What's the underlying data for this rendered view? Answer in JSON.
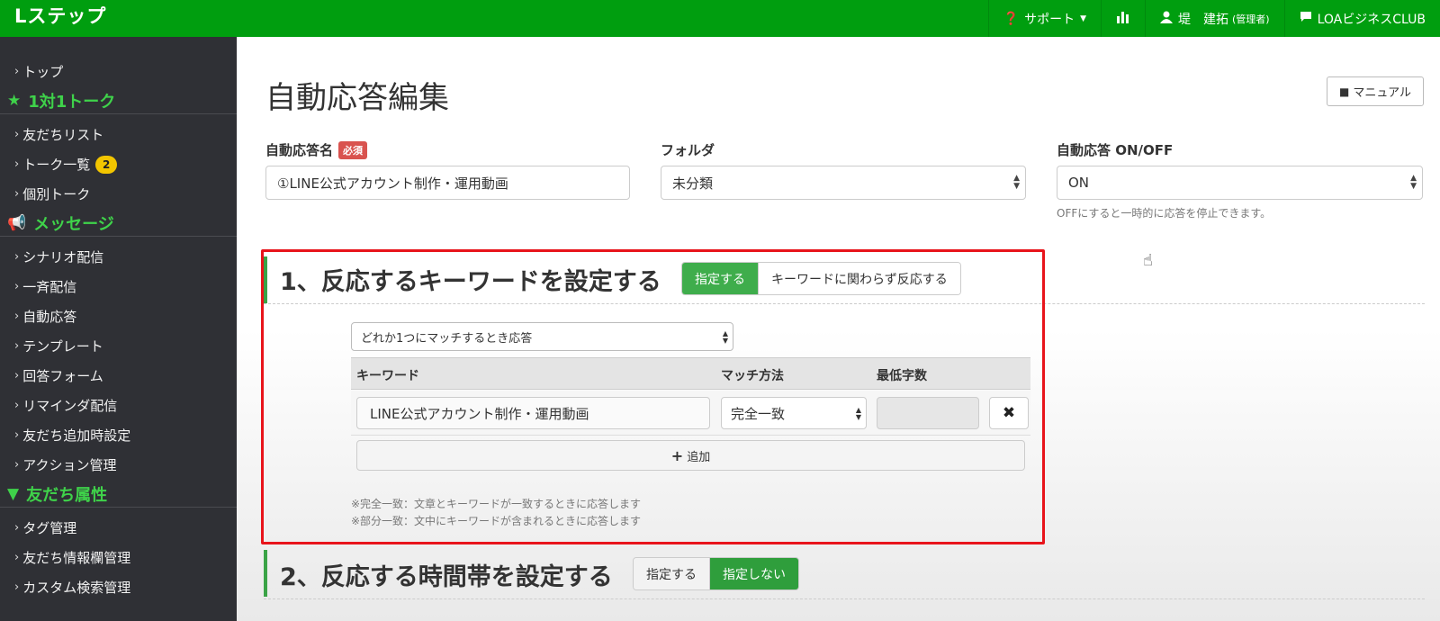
{
  "app": {
    "logo": "Lステップ"
  },
  "topnav": {
    "support": "サポート",
    "user_name": "堤　建拓",
    "user_role": "(管理者)",
    "club": "LOAビジネスCLUB"
  },
  "sidebar": {
    "items": [
      {
        "label": "トップ"
      },
      {
        "header": "1対1トーク",
        "icon": "star-icon"
      },
      {
        "label": "友だちリスト"
      },
      {
        "label": "トーク一覧",
        "badge": "2"
      },
      {
        "label": "個別トーク"
      },
      {
        "header": "メッセージ",
        "icon": "megaphone-icon"
      },
      {
        "label": "シナリオ配信"
      },
      {
        "label": "一斉配信"
      },
      {
        "label": "自動応答"
      },
      {
        "label": "テンプレート"
      },
      {
        "label": "回答フォーム"
      },
      {
        "label": "リマインダ配信"
      },
      {
        "label": "友だち追加時設定"
      },
      {
        "label": "アクション管理"
      },
      {
        "header": "友だち属性",
        "icon": "filter-icon"
      },
      {
        "label": "タグ管理"
      },
      {
        "label": "友だち情報欄管理"
      },
      {
        "label": "カスタム検索管理"
      }
    ]
  },
  "main": {
    "title": "自動応答編集",
    "manual_label": "マニュアル",
    "name_label": "自動応答名",
    "required_badge": "必須",
    "name_value": "①LINE公式アカウント制作・運用動画",
    "folder_label": "フォルダ",
    "folder_value": "未分類",
    "onoff_label": "自動応答 ON/OFF",
    "onoff_value": "ON",
    "onoff_hint": "OFFにすると一時的に応答を停止できます。"
  },
  "section1": {
    "title": "1、反応するキーワードを設定する",
    "opt_set": "指定する",
    "opt_any": "キーワードに関わらず反応する",
    "match_mode": "どれか1つにマッチするとき応答",
    "col_keyword": "キーワード",
    "col_method": "マッチ方法",
    "col_min": "最低字数",
    "row_keyword": "LINE公式アカウント制作・運用動画",
    "row_method": "完全一致",
    "add_label": "追加",
    "note1": "※完全一致：文章とキーワードが一致するときに応答します",
    "note2": "※部分一致：文中にキーワードが含まれるときに応答します"
  },
  "section2": {
    "title": "2、反応する時間帯を設定する",
    "opt_set": "指定する",
    "opt_none": "指定しない"
  },
  "colors": {
    "brand_green": "#009e0f",
    "sidebar_bg": "#2f3035",
    "highlight_red": "#e8141b"
  }
}
